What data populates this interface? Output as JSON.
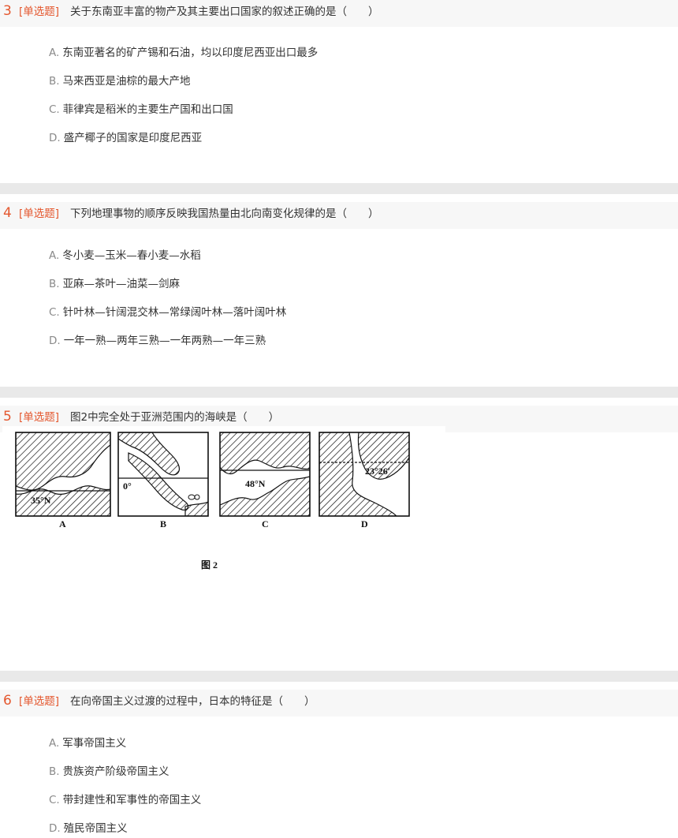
{
  "questions": [
    {
      "number": "3",
      "type": "[单选题]",
      "text": "关于东南亚丰富的物产及其主要出口国家的叙述正确的是（　　）",
      "options": [
        {
          "letter": "A.",
          "text": "东南亚著名的矿产锡和石油，均以印度尼西亚出口最多"
        },
        {
          "letter": "B.",
          "text": "马来西亚是油棕的最大产地"
        },
        {
          "letter": "C.",
          "text": "菲律宾是稻米的主要生产国和出口国"
        },
        {
          "letter": "D.",
          "text": "盛产椰子的国家是印度尼西亚"
        }
      ]
    },
    {
      "number": "4",
      "type": "[单选题]",
      "text": "下列地理事物的顺序反映我国热量由北向南变化规律的是（　　）",
      "options": [
        {
          "letter": "A.",
          "text": "冬小麦—玉米—春小麦—水稻"
        },
        {
          "letter": "B.",
          "text": "亚麻—茶叶—油菜—剑麻"
        },
        {
          "letter": "C.",
          "text": "针叶林—针阔混交林—常绿阔叶林—落叶阔叶林"
        },
        {
          "letter": "D.",
          "text": "一年一熟—两年三熟—一年两熟—一年三熟"
        }
      ]
    },
    {
      "number": "5",
      "type": "[单选题]",
      "text": "图2中完全处于亚洲范围内的海峡是（　　）",
      "figure": {
        "maps": [
          {
            "label": "A",
            "coord": "35°N"
          },
          {
            "label": "B",
            "coord": "0°"
          },
          {
            "label": "C",
            "coord": "48°N"
          },
          {
            "label": "D",
            "coord": "23°26′"
          }
        ],
        "caption": "图 2"
      }
    },
    {
      "number": "6",
      "type": "[单选题]",
      "text": "在向帝国主义过渡的过程中，日本的特征是（　　）",
      "options": [
        {
          "letter": "A.",
          "text": "军事帝国主义"
        },
        {
          "letter": "B.",
          "text": "贵族资产阶级帝国主义"
        },
        {
          "letter": "C.",
          "text": "带封建性和军事性的帝国主义"
        },
        {
          "letter": "D.",
          "text": "殖民帝国主义"
        }
      ]
    }
  ],
  "colors": {
    "accent": "#e4572e",
    "header_bg": "#f7f7f7",
    "divider": "#e9e9e9",
    "text": "#333333",
    "option_letter": "#8a8a8a"
  }
}
